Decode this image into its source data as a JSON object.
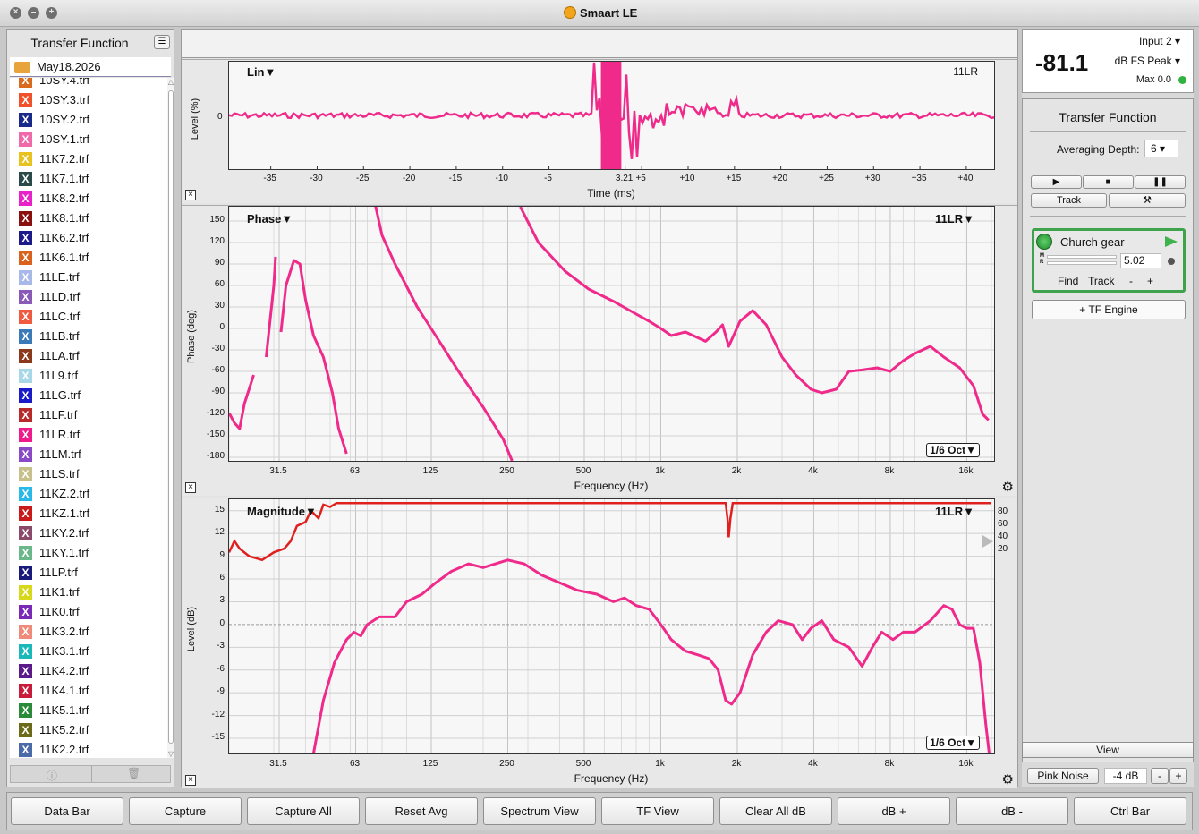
{
  "window": {
    "title": "Smaart LE"
  },
  "left_panel": {
    "title": "Transfer Function",
    "folder": "May18.2026",
    "items": [
      {
        "label": "10SY.4.trf",
        "color": "#d96a1e"
      },
      {
        "label": "10SY.3.trf",
        "color": "#f0502a"
      },
      {
        "label": "10SY.2.trf",
        "color": "#1a2a8a"
      },
      {
        "label": "10SY.1.trf",
        "color": "#f06aaa"
      },
      {
        "label": "11K7.2.trf",
        "color": "#e8c21e"
      },
      {
        "label": "11K7.1.trf",
        "color": "#2a4a4a"
      },
      {
        "label": "11K8.2.trf",
        "color": "#e822c8"
      },
      {
        "label": "11K8.1.trf",
        "color": "#8a1010"
      },
      {
        "label": "11K6.2.trf",
        "color": "#1a1a8a"
      },
      {
        "label": "11K6.1.trf",
        "color": "#d9621e"
      },
      {
        "label": "11LE.trf",
        "color": "#a8b8e8"
      },
      {
        "label": "11LD.trf",
        "color": "#8a5ab8"
      },
      {
        "label": "11LC.trf",
        "color": "#f05a40"
      },
      {
        "label": "11LB.trf",
        "color": "#3a7ab8"
      },
      {
        "label": "11LA.trf",
        "color": "#8a3a1a"
      },
      {
        "label": "11L9.trf",
        "color": "#a8d8e8"
      },
      {
        "label": "11LG.trf",
        "color": "#1a1ac8"
      },
      {
        "label": "11LF.trf",
        "color": "#b82a2a"
      },
      {
        "label": "11LR.trf",
        "color": "#f01a8a"
      },
      {
        "label": "11LM.trf",
        "color": "#8a4ac8"
      },
      {
        "label": "11LS.trf",
        "color": "#c8c08a"
      },
      {
        "label": "11KZ.2.trf",
        "color": "#2ab8e8"
      },
      {
        "label": "11KZ.1.trf",
        "color": "#c81a1a"
      },
      {
        "label": "11KY.2.trf",
        "color": "#8a4a6a"
      },
      {
        "label": "11KY.1.trf",
        "color": "#6ab88a"
      },
      {
        "label": "11LP.trf",
        "color": "#1a1a7a"
      },
      {
        "label": "11K1.trf",
        "color": "#d8d81a"
      },
      {
        "label": "11K0.trf",
        "color": "#7a2ab8"
      },
      {
        "label": "11K3.2.trf",
        "color": "#f08a7a"
      },
      {
        "label": "11K3.1.trf",
        "color": "#1ab8b8"
      },
      {
        "label": "11K4.2.trf",
        "color": "#5a1a8a"
      },
      {
        "label": "11K4.1.trf",
        "color": "#c81a3a"
      },
      {
        "label": "11K5.1.trf",
        "color": "#2a8a3a"
      },
      {
        "label": "11K5.2.trf",
        "color": "#6a6a1a"
      },
      {
        "label": "11K2.2.trf",
        "color": "#4a6aa8"
      }
    ]
  },
  "impulse": {
    "label": "Lin▼",
    "trace": "11LR",
    "ylabel": "Level (%)",
    "xlabel": "Time (ms)",
    "ytick": "0",
    "xticks": [
      "-35",
      "-30",
      "-25",
      "-20",
      "-15",
      "-10",
      "-5",
      "3.21",
      "+5",
      "+10",
      "+15",
      "+20",
      "+25",
      "+30",
      "+35",
      "+40"
    ]
  },
  "phase": {
    "label": "Phase▼",
    "trace": "11LR▼",
    "ylabel": "Phase (deg)",
    "xlabel": "Frequency (Hz)",
    "smoothing": "1/6 Oct▼",
    "yticks": [
      "150",
      "120",
      "90",
      "60",
      "30",
      "0",
      "-30",
      "-60",
      "-90",
      "-120",
      "-150",
      "-180"
    ],
    "xticks": [
      "31.5",
      "63",
      "125",
      "250",
      "500",
      "1k",
      "2k",
      "4k",
      "8k",
      "16k"
    ]
  },
  "magnitude": {
    "label": "Magnitude▼",
    "trace": "11LR▼",
    "ylabel": "Level (dB)",
    "xlabel": "Frequency (Hz)",
    "smoothing": "1/6 Oct▼",
    "yticks": [
      "15",
      "12",
      "9",
      "6",
      "3",
      "0",
      "-3",
      "-6",
      "-9",
      "-12",
      "-15"
    ],
    "xticks": [
      "31.5",
      "63",
      "125",
      "250",
      "500",
      "1k",
      "2k",
      "4k",
      "8k",
      "16k"
    ],
    "coh_ticks": [
      "80",
      "60",
      "40",
      "20"
    ]
  },
  "chart_data": [
    {
      "type": "line",
      "title": "",
      "xlabel": "Time (ms)",
      "ylabel": "Level (%)",
      "xlim": [
        -40,
        43
      ],
      "series": [
        {
          "values": []
        }
      ]
    },
    {
      "type": "line",
      "title": "",
      "xlabel": "Frequency (Hz)",
      "ylabel": "Phase (deg)",
      "ylim": [
        -180,
        170
      ],
      "x": [
        20,
        25,
        31.5,
        40,
        50,
        63,
        80,
        100,
        125,
        160,
        200,
        250,
        315,
        400,
        500,
        630,
        800,
        1000,
        1250,
        1600,
        2000,
        2500,
        3150,
        4000,
        5000,
        6300,
        8000,
        10000,
        12500,
        16000,
        20000
      ],
      "series": [
        {
          "values": [
            -120,
            -70,
            -40,
            90,
            -130,
            180,
            60,
            -20,
            -100,
            -160,
            140,
            80,
            50,
            35,
            25,
            10,
            -5,
            -15,
            -10,
            10,
            25,
            -40,
            -90,
            -95,
            -60,
            -65,
            -40,
            -30,
            -55,
            -110,
            -125
          ]
        }
      ]
    },
    {
      "type": "line",
      "title": "",
      "xlabel": "Frequency (Hz)",
      "ylabel": "Level (dB)",
      "ylim": [
        -17,
        16
      ],
      "x": [
        40,
        45,
        50,
        63,
        80,
        100,
        125,
        160,
        200,
        250,
        315,
        400,
        500,
        630,
        800,
        1000,
        1250,
        1600,
        2000,
        2500,
        3150,
        4000,
        5000,
        6300,
        8000,
        10000,
        12500,
        16000,
        20000
      ],
      "series": [
        {
          "values": [
            -17,
            -6,
            -3,
            0,
            1,
            3,
            5,
            7,
            8,
            8.5,
            7,
            5.5,
            4.5,
            3,
            3.5,
            1,
            -3,
            -5,
            -9,
            -1,
            1,
            -2,
            0,
            -5,
            -3,
            -1,
            2,
            0,
            -20
          ]
        }
      ]
    }
  ],
  "meter": {
    "value": "-81.1",
    "input": "Input 2",
    "unit": "dB FS Peak",
    "max": "Max 0.0"
  },
  "right_panel": {
    "title": "Transfer Function",
    "averaging_label": "Averaging Depth:",
    "averaging_value": "6",
    "track_label": "Track",
    "engine_name": "Church gear",
    "delay_value": "5.02",
    "find_label": "Find",
    "track2_label": "Track",
    "minus": "-",
    "plus": "+",
    "add_engine": "+ TF Engine",
    "view_label": "View",
    "pink_noise": "Pink Noise",
    "noise_level": "-4 dB"
  },
  "bottom_buttons": [
    "Data Bar",
    "Capture",
    "Capture All",
    "Reset Avg",
    "Spectrum View",
    "TF View",
    "Clear All dB",
    "dB +",
    "dB -",
    "Ctrl Bar"
  ]
}
